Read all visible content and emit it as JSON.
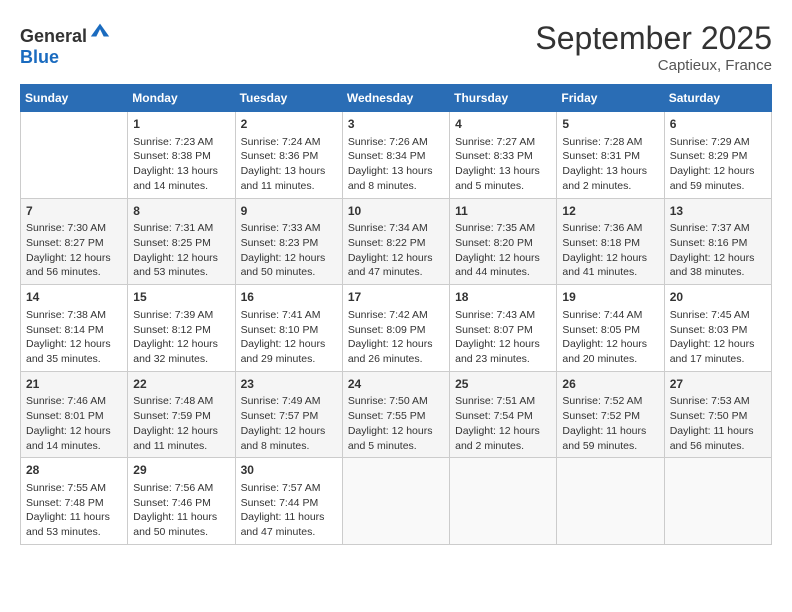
{
  "header": {
    "logo_general": "General",
    "logo_blue": "Blue",
    "month": "September 2025",
    "location": "Captieux, France"
  },
  "days_of_week": [
    "Sunday",
    "Monday",
    "Tuesday",
    "Wednesday",
    "Thursday",
    "Friday",
    "Saturday"
  ],
  "weeks": [
    [
      {
        "day": "",
        "content": ""
      },
      {
        "day": "1",
        "content": "Sunrise: 7:23 AM\nSunset: 8:38 PM\nDaylight: 13 hours and 14 minutes."
      },
      {
        "day": "2",
        "content": "Sunrise: 7:24 AM\nSunset: 8:36 PM\nDaylight: 13 hours and 11 minutes."
      },
      {
        "day": "3",
        "content": "Sunrise: 7:26 AM\nSunset: 8:34 PM\nDaylight: 13 hours and 8 minutes."
      },
      {
        "day": "4",
        "content": "Sunrise: 7:27 AM\nSunset: 8:33 PM\nDaylight: 13 hours and 5 minutes."
      },
      {
        "day": "5",
        "content": "Sunrise: 7:28 AM\nSunset: 8:31 PM\nDaylight: 13 hours and 2 minutes."
      },
      {
        "day": "6",
        "content": "Sunrise: 7:29 AM\nSunset: 8:29 PM\nDaylight: 12 hours and 59 minutes."
      }
    ],
    [
      {
        "day": "7",
        "content": "Sunrise: 7:30 AM\nSunset: 8:27 PM\nDaylight: 12 hours and 56 minutes."
      },
      {
        "day": "8",
        "content": "Sunrise: 7:31 AM\nSunset: 8:25 PM\nDaylight: 12 hours and 53 minutes."
      },
      {
        "day": "9",
        "content": "Sunrise: 7:33 AM\nSunset: 8:23 PM\nDaylight: 12 hours and 50 minutes."
      },
      {
        "day": "10",
        "content": "Sunrise: 7:34 AM\nSunset: 8:22 PM\nDaylight: 12 hours and 47 minutes."
      },
      {
        "day": "11",
        "content": "Sunrise: 7:35 AM\nSunset: 8:20 PM\nDaylight: 12 hours and 44 minutes."
      },
      {
        "day": "12",
        "content": "Sunrise: 7:36 AM\nSunset: 8:18 PM\nDaylight: 12 hours and 41 minutes."
      },
      {
        "day": "13",
        "content": "Sunrise: 7:37 AM\nSunset: 8:16 PM\nDaylight: 12 hours and 38 minutes."
      }
    ],
    [
      {
        "day": "14",
        "content": "Sunrise: 7:38 AM\nSunset: 8:14 PM\nDaylight: 12 hours and 35 minutes."
      },
      {
        "day": "15",
        "content": "Sunrise: 7:39 AM\nSunset: 8:12 PM\nDaylight: 12 hours and 32 minutes."
      },
      {
        "day": "16",
        "content": "Sunrise: 7:41 AM\nSunset: 8:10 PM\nDaylight: 12 hours and 29 minutes."
      },
      {
        "day": "17",
        "content": "Sunrise: 7:42 AM\nSunset: 8:09 PM\nDaylight: 12 hours and 26 minutes."
      },
      {
        "day": "18",
        "content": "Sunrise: 7:43 AM\nSunset: 8:07 PM\nDaylight: 12 hours and 23 minutes."
      },
      {
        "day": "19",
        "content": "Sunrise: 7:44 AM\nSunset: 8:05 PM\nDaylight: 12 hours and 20 minutes."
      },
      {
        "day": "20",
        "content": "Sunrise: 7:45 AM\nSunset: 8:03 PM\nDaylight: 12 hours and 17 minutes."
      }
    ],
    [
      {
        "day": "21",
        "content": "Sunrise: 7:46 AM\nSunset: 8:01 PM\nDaylight: 12 hours and 14 minutes."
      },
      {
        "day": "22",
        "content": "Sunrise: 7:48 AM\nSunset: 7:59 PM\nDaylight: 12 hours and 11 minutes."
      },
      {
        "day": "23",
        "content": "Sunrise: 7:49 AM\nSunset: 7:57 PM\nDaylight: 12 hours and 8 minutes."
      },
      {
        "day": "24",
        "content": "Sunrise: 7:50 AM\nSunset: 7:55 PM\nDaylight: 12 hours and 5 minutes."
      },
      {
        "day": "25",
        "content": "Sunrise: 7:51 AM\nSunset: 7:54 PM\nDaylight: 12 hours and 2 minutes."
      },
      {
        "day": "26",
        "content": "Sunrise: 7:52 AM\nSunset: 7:52 PM\nDaylight: 11 hours and 59 minutes."
      },
      {
        "day": "27",
        "content": "Sunrise: 7:53 AM\nSunset: 7:50 PM\nDaylight: 11 hours and 56 minutes."
      }
    ],
    [
      {
        "day": "28",
        "content": "Sunrise: 7:55 AM\nSunset: 7:48 PM\nDaylight: 11 hours and 53 minutes."
      },
      {
        "day": "29",
        "content": "Sunrise: 7:56 AM\nSunset: 7:46 PM\nDaylight: 11 hours and 50 minutes."
      },
      {
        "day": "30",
        "content": "Sunrise: 7:57 AM\nSunset: 7:44 PM\nDaylight: 11 hours and 47 minutes."
      },
      {
        "day": "",
        "content": ""
      },
      {
        "day": "",
        "content": ""
      },
      {
        "day": "",
        "content": ""
      },
      {
        "day": "",
        "content": ""
      }
    ]
  ]
}
